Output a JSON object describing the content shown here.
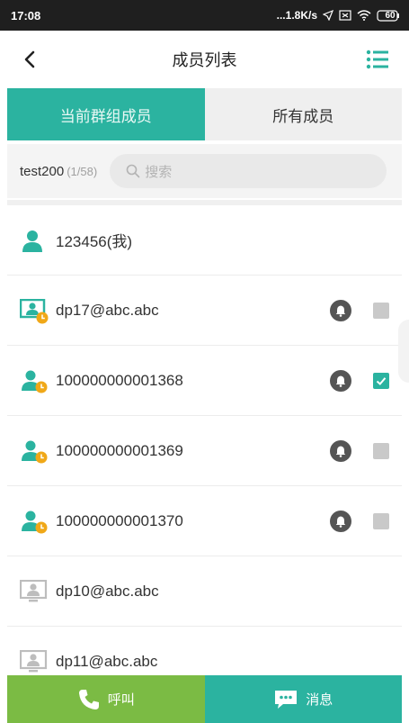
{
  "status": {
    "time": "17:08",
    "network": "...1.8K/s",
    "battery": "60"
  },
  "header": {
    "title": "成员列表"
  },
  "tabs": [
    {
      "label": "当前群组成员",
      "active": true
    },
    {
      "label": "所有成员",
      "active": false
    }
  ],
  "filter": {
    "group_name": "test200",
    "group_count": "(1/58)",
    "search_placeholder": "搜索"
  },
  "members": [
    {
      "name": "123456(我)",
      "icon": "user-icon",
      "bell": false,
      "checked": null
    },
    {
      "name": "dp17@abc.abc",
      "icon": "device-clock-icon",
      "bell": true,
      "checked": false
    },
    {
      "name": "100000000001368",
      "icon": "user-clock-icon",
      "bell": true,
      "checked": true
    },
    {
      "name": "100000000001369",
      "icon": "user-clock-icon",
      "bell": true,
      "checked": false
    },
    {
      "name": "100000000001370",
      "icon": "user-clock-icon",
      "bell": true,
      "checked": false
    },
    {
      "name": "dp10@abc.abc",
      "icon": "device-offline-icon",
      "bell": false,
      "checked": null
    },
    {
      "name": "dp11@abc.abc",
      "icon": "device-offline-icon",
      "bell": false,
      "checked": null
    }
  ],
  "footer": {
    "call_label": "呼叫",
    "message_label": "消息"
  },
  "colors": {
    "accent": "#2bb3a0",
    "call": "#7bbb44",
    "clock": "#f0a818"
  }
}
